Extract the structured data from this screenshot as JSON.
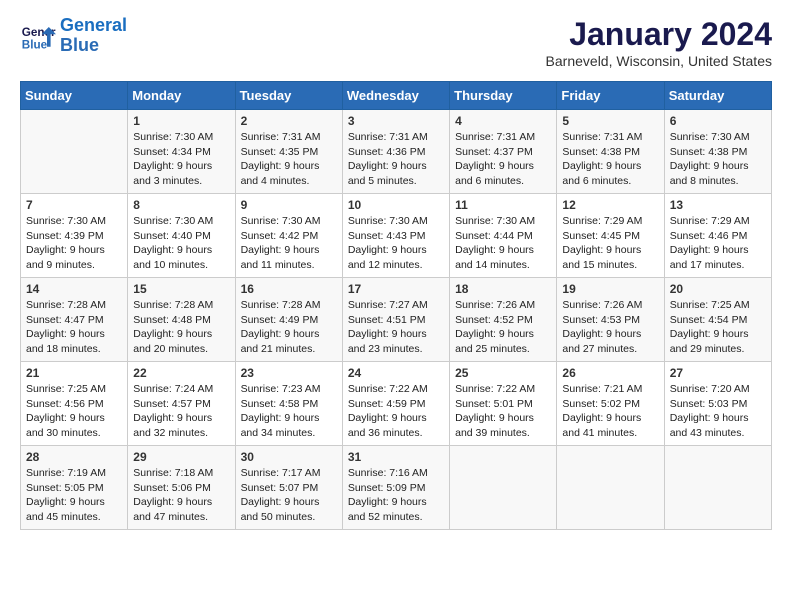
{
  "header": {
    "logo_line1": "General",
    "logo_line2": "Blue",
    "month": "January 2024",
    "location": "Barneveld, Wisconsin, United States"
  },
  "days_of_week": [
    "Sunday",
    "Monday",
    "Tuesday",
    "Wednesday",
    "Thursday",
    "Friday",
    "Saturday"
  ],
  "weeks": [
    [
      {
        "day": "",
        "info": ""
      },
      {
        "day": "1",
        "info": "Sunrise: 7:30 AM\nSunset: 4:34 PM\nDaylight: 9 hours\nand 3 minutes."
      },
      {
        "day": "2",
        "info": "Sunrise: 7:31 AM\nSunset: 4:35 PM\nDaylight: 9 hours\nand 4 minutes."
      },
      {
        "day": "3",
        "info": "Sunrise: 7:31 AM\nSunset: 4:36 PM\nDaylight: 9 hours\nand 5 minutes."
      },
      {
        "day": "4",
        "info": "Sunrise: 7:31 AM\nSunset: 4:37 PM\nDaylight: 9 hours\nand 6 minutes."
      },
      {
        "day": "5",
        "info": "Sunrise: 7:31 AM\nSunset: 4:38 PM\nDaylight: 9 hours\nand 6 minutes."
      },
      {
        "day": "6",
        "info": "Sunrise: 7:30 AM\nSunset: 4:38 PM\nDaylight: 9 hours\nand 8 minutes."
      }
    ],
    [
      {
        "day": "7",
        "info": "Sunrise: 7:30 AM\nSunset: 4:39 PM\nDaylight: 9 hours\nand 9 minutes."
      },
      {
        "day": "8",
        "info": "Sunrise: 7:30 AM\nSunset: 4:40 PM\nDaylight: 9 hours\nand 10 minutes."
      },
      {
        "day": "9",
        "info": "Sunrise: 7:30 AM\nSunset: 4:42 PM\nDaylight: 9 hours\nand 11 minutes."
      },
      {
        "day": "10",
        "info": "Sunrise: 7:30 AM\nSunset: 4:43 PM\nDaylight: 9 hours\nand 12 minutes."
      },
      {
        "day": "11",
        "info": "Sunrise: 7:30 AM\nSunset: 4:44 PM\nDaylight: 9 hours\nand 14 minutes."
      },
      {
        "day": "12",
        "info": "Sunrise: 7:29 AM\nSunset: 4:45 PM\nDaylight: 9 hours\nand 15 minutes."
      },
      {
        "day": "13",
        "info": "Sunrise: 7:29 AM\nSunset: 4:46 PM\nDaylight: 9 hours\nand 17 minutes."
      }
    ],
    [
      {
        "day": "14",
        "info": "Sunrise: 7:28 AM\nSunset: 4:47 PM\nDaylight: 9 hours\nand 18 minutes."
      },
      {
        "day": "15",
        "info": "Sunrise: 7:28 AM\nSunset: 4:48 PM\nDaylight: 9 hours\nand 20 minutes."
      },
      {
        "day": "16",
        "info": "Sunrise: 7:28 AM\nSunset: 4:49 PM\nDaylight: 9 hours\nand 21 minutes."
      },
      {
        "day": "17",
        "info": "Sunrise: 7:27 AM\nSunset: 4:51 PM\nDaylight: 9 hours\nand 23 minutes."
      },
      {
        "day": "18",
        "info": "Sunrise: 7:26 AM\nSunset: 4:52 PM\nDaylight: 9 hours\nand 25 minutes."
      },
      {
        "day": "19",
        "info": "Sunrise: 7:26 AM\nSunset: 4:53 PM\nDaylight: 9 hours\nand 27 minutes."
      },
      {
        "day": "20",
        "info": "Sunrise: 7:25 AM\nSunset: 4:54 PM\nDaylight: 9 hours\nand 29 minutes."
      }
    ],
    [
      {
        "day": "21",
        "info": "Sunrise: 7:25 AM\nSunset: 4:56 PM\nDaylight: 9 hours\nand 30 minutes."
      },
      {
        "day": "22",
        "info": "Sunrise: 7:24 AM\nSunset: 4:57 PM\nDaylight: 9 hours\nand 32 minutes."
      },
      {
        "day": "23",
        "info": "Sunrise: 7:23 AM\nSunset: 4:58 PM\nDaylight: 9 hours\nand 34 minutes."
      },
      {
        "day": "24",
        "info": "Sunrise: 7:22 AM\nSunset: 4:59 PM\nDaylight: 9 hours\nand 36 minutes."
      },
      {
        "day": "25",
        "info": "Sunrise: 7:22 AM\nSunset: 5:01 PM\nDaylight: 9 hours\nand 39 minutes."
      },
      {
        "day": "26",
        "info": "Sunrise: 7:21 AM\nSunset: 5:02 PM\nDaylight: 9 hours\nand 41 minutes."
      },
      {
        "day": "27",
        "info": "Sunrise: 7:20 AM\nSunset: 5:03 PM\nDaylight: 9 hours\nand 43 minutes."
      }
    ],
    [
      {
        "day": "28",
        "info": "Sunrise: 7:19 AM\nSunset: 5:05 PM\nDaylight: 9 hours\nand 45 minutes."
      },
      {
        "day": "29",
        "info": "Sunrise: 7:18 AM\nSunset: 5:06 PM\nDaylight: 9 hours\nand 47 minutes."
      },
      {
        "day": "30",
        "info": "Sunrise: 7:17 AM\nSunset: 5:07 PM\nDaylight: 9 hours\nand 50 minutes."
      },
      {
        "day": "31",
        "info": "Sunrise: 7:16 AM\nSunset: 5:09 PM\nDaylight: 9 hours\nand 52 minutes."
      },
      {
        "day": "",
        "info": ""
      },
      {
        "day": "",
        "info": ""
      },
      {
        "day": "",
        "info": ""
      }
    ]
  ]
}
